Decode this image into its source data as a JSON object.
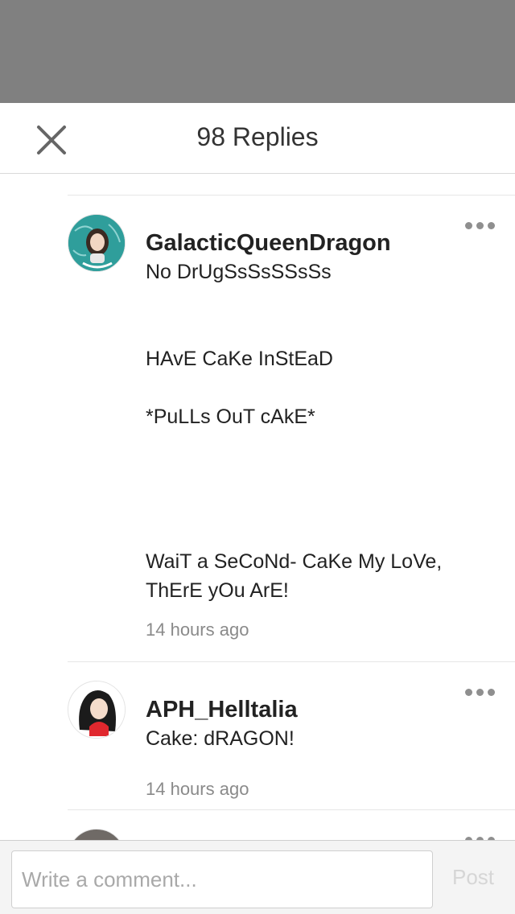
{
  "header": {
    "title": "98 Replies"
  },
  "comments": [
    {
      "username": "GalacticQueenDragon",
      "body": "No DrUgSsSsSSsSs\n\n\nHAvE CaKe InStEaD\n\n*PuLLs OuT cAkE*\n\n\n\n\nWaiT a SeCoNd- CaKe My LoVe, ThErE yOu ArE!",
      "time": "14 hours ago"
    },
    {
      "username": "APH_Helltalia",
      "body": "Cake: dRAGON!",
      "time": "14 hours ago"
    }
  ],
  "footer": {
    "placeholder": "Write a comment...",
    "post_label": "Post"
  },
  "colors": {
    "dim_overlay": "#808080",
    "teal_avatar": "#2f9e9b",
    "accent_red": "#e0282e"
  }
}
